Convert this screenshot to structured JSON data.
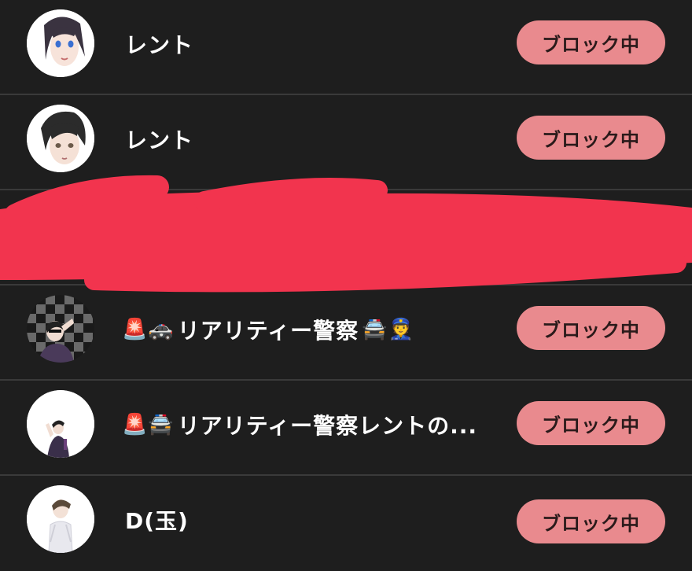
{
  "rows": [
    {
      "name": "レント",
      "button": "ブロック中",
      "avatar_icon": "anime-girl-avatar",
      "emoji_prefix": "",
      "emoji_suffix": ""
    },
    {
      "name": "レント",
      "button": "ブロック中",
      "avatar_icon": "anime-boy-avatar",
      "emoji_prefix": "",
      "emoji_suffix": ""
    },
    {
      "name": "",
      "button": "",
      "avatar_icon": "",
      "emoji_prefix": "",
      "emoji_suffix": "",
      "redacted": true
    },
    {
      "name": "リアリティー警察",
      "button": "ブロック中",
      "avatar_icon": "checkered-background-avatar",
      "emoji_prefix": "🚨🚓",
      "emoji_suffix": "🚔👮"
    },
    {
      "name": "リアリティー警察レントの...",
      "button": "ブロック中",
      "avatar_icon": "saluting-person-avatar",
      "emoji_prefix": "🚨🚔",
      "emoji_suffix": ""
    },
    {
      "name": "D(玉)",
      "button": "ブロック中",
      "avatar_icon": "standing-character-avatar",
      "emoji_prefix": "",
      "emoji_suffix": ""
    }
  ],
  "colors": {
    "background": "#1e1e1e",
    "divider": "#3a3a3a",
    "button_bg": "#e98a8e",
    "redaction": "#f2344e"
  }
}
